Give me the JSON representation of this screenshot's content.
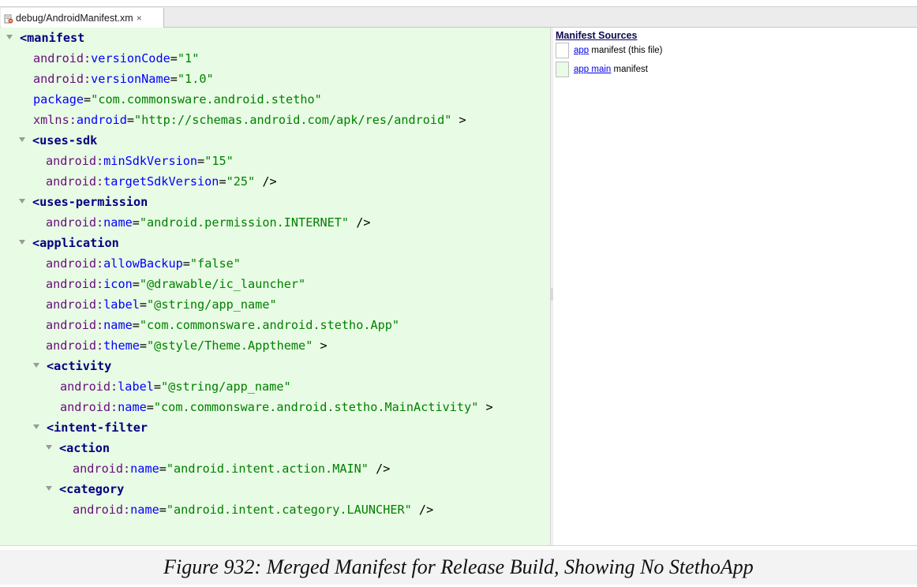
{
  "tab": {
    "label": "debug/AndroidManifest.xm",
    "close": "×"
  },
  "sources": {
    "title": "Manifest Sources",
    "items": [
      {
        "link": "app",
        "text": " manifest (this file)",
        "color": "#ffffff"
      },
      {
        "link": "app main",
        "text": " manifest",
        "color": "#e8fbe4"
      }
    ]
  },
  "code": [
    {
      "fold": true,
      "parts": [
        [
          "lt",
          "<"
        ],
        [
          "tg",
          "manifest"
        ]
      ]
    },
    {
      "fold": false,
      "parts": [
        [
          "ns",
          "android:"
        ],
        [
          "at",
          "versionCode"
        ],
        [
          "eq",
          "="
        ],
        [
          "vl",
          "\"1\""
        ]
      ]
    },
    {
      "fold": false,
      "parts": [
        [
          "ns",
          "android:"
        ],
        [
          "at",
          "versionName"
        ],
        [
          "eq",
          "="
        ],
        [
          "vl",
          "\"1.0\""
        ]
      ]
    },
    {
      "fold": false,
      "parts": [
        [
          "at",
          "package"
        ],
        [
          "eq",
          "="
        ],
        [
          "vl",
          "\"com.commonsware.android.stetho\""
        ]
      ]
    },
    {
      "fold": false,
      "parts": [
        [
          "ns",
          "xmlns:"
        ],
        [
          "at",
          "android"
        ],
        [
          "eq",
          "="
        ],
        [
          "vl",
          "\"http://schemas.android.com/apk/res/android\""
        ],
        [
          "pn",
          " >"
        ]
      ]
    },
    {
      "fold": true,
      "parts": [
        [
          "lt",
          "<"
        ],
        [
          "tg",
          "uses-sdk"
        ]
      ]
    },
    {
      "fold": false,
      "parts": [
        [
          "ns",
          "android:"
        ],
        [
          "at",
          "minSdkVersion"
        ],
        [
          "eq",
          "="
        ],
        [
          "vl",
          "\"15\""
        ]
      ]
    },
    {
      "fold": false,
      "parts": [
        [
          "ns",
          "android:"
        ],
        [
          "at",
          "targetSdkVersion"
        ],
        [
          "eq",
          "="
        ],
        [
          "vl",
          "\"25\""
        ],
        [
          "pn",
          " />"
        ]
      ]
    },
    {
      "fold": true,
      "parts": [
        [
          "lt",
          "<"
        ],
        [
          "tg",
          "uses-permission"
        ]
      ]
    },
    {
      "fold": false,
      "parts": [
        [
          "ns",
          "android:"
        ],
        [
          "at",
          "name"
        ],
        [
          "eq",
          "="
        ],
        [
          "vl",
          "\"android.permission.INTERNET\""
        ],
        [
          "pn",
          " />"
        ]
      ]
    },
    {
      "fold": true,
      "parts": [
        [
          "lt",
          "<"
        ],
        [
          "tg",
          "application"
        ]
      ]
    },
    {
      "fold": false,
      "parts": [
        [
          "ns",
          "android:"
        ],
        [
          "at",
          "allowBackup"
        ],
        [
          "eq",
          "="
        ],
        [
          "vl",
          "\"false\""
        ]
      ]
    },
    {
      "fold": false,
      "parts": [
        [
          "ns",
          "android:"
        ],
        [
          "at",
          "icon"
        ],
        [
          "eq",
          "="
        ],
        [
          "vl",
          "\"@drawable/ic_launcher\""
        ]
      ]
    },
    {
      "fold": false,
      "parts": [
        [
          "ns",
          "android:"
        ],
        [
          "at",
          "label"
        ],
        [
          "eq",
          "="
        ],
        [
          "vl",
          "\"@string/app_name\""
        ]
      ]
    },
    {
      "fold": false,
      "parts": [
        [
          "ns",
          "android:"
        ],
        [
          "at",
          "name"
        ],
        [
          "eq",
          "="
        ],
        [
          "vl",
          "\"com.commonsware.android.stetho.App\""
        ]
      ]
    },
    {
      "fold": false,
      "parts": [
        [
          "ns",
          "android:"
        ],
        [
          "at",
          "theme"
        ],
        [
          "eq",
          "="
        ],
        [
          "vl",
          "\"@style/Theme.Apptheme\""
        ],
        [
          "pn",
          " >"
        ]
      ]
    },
    {
      "fold": true,
      "parts": [
        [
          "lt",
          "<"
        ],
        [
          "tg",
          "activity"
        ]
      ]
    },
    {
      "fold": false,
      "parts": [
        [
          "ns",
          "android:"
        ],
        [
          "at",
          "label"
        ],
        [
          "eq",
          "="
        ],
        [
          "vl",
          "\"@string/app_name\""
        ]
      ]
    },
    {
      "fold": false,
      "parts": [
        [
          "ns",
          "android:"
        ],
        [
          "at",
          "name"
        ],
        [
          "eq",
          "="
        ],
        [
          "vl",
          "\"com.commonsware.android.stetho.MainActivity\""
        ],
        [
          "pn",
          " >"
        ]
      ]
    },
    {
      "fold": true,
      "parts": [
        [
          "lt",
          "<"
        ],
        [
          "tg",
          "intent-filter"
        ]
      ]
    },
    {
      "fold": true,
      "parts": [
        [
          "lt",
          "<"
        ],
        [
          "tg",
          "action"
        ]
      ]
    },
    {
      "fold": false,
      "parts": [
        [
          "ns",
          "android:"
        ],
        [
          "at",
          "name"
        ],
        [
          "eq",
          "="
        ],
        [
          "vl",
          "\"android.intent.action.MAIN\""
        ],
        [
          "pn",
          " />"
        ]
      ]
    },
    {
      "fold": true,
      "parts": [
        [
          "lt",
          "<"
        ],
        [
          "tg",
          "category"
        ]
      ]
    },
    {
      "fold": false,
      "parts": [
        [
          "ns",
          "android:"
        ],
        [
          "at",
          "name"
        ],
        [
          "eq",
          "="
        ],
        [
          "vl",
          "\"android.intent.category.LAUNCHER\""
        ],
        [
          "pn",
          " />"
        ]
      ]
    }
  ],
  "caption": "Figure 932: Merged Manifest for Release Build, Showing No StethoApp"
}
